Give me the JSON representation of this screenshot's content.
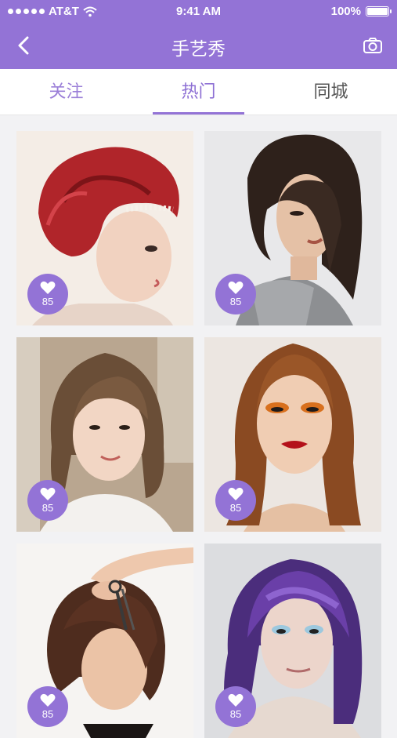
{
  "status_bar": {
    "carrier": "AT&T",
    "time": "9:41 AM",
    "battery": "100%",
    "battery_level": 1.0
  },
  "nav": {
    "title": "手艺秀"
  },
  "tabs": [
    {
      "label": "关注"
    },
    {
      "label": "热门"
    },
    {
      "label": "同城"
    }
  ],
  "active_tab": "热门",
  "posts": [
    {
      "likes": "85",
      "style": "red-updo"
    },
    {
      "likes": "85",
      "style": "dark-asymmetric-bob"
    },
    {
      "likes": "85",
      "style": "brown-medium"
    },
    {
      "likes": "85",
      "style": "copper-lob"
    },
    {
      "likes": "85",
      "style": "short-bob-scissors"
    },
    {
      "likes": "85",
      "style": "purple-bob"
    }
  ],
  "colors": {
    "accent": "#9373d6",
    "inactive_tab": "#555555"
  }
}
